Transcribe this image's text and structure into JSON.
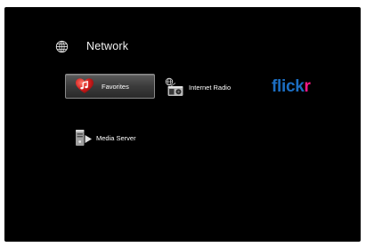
{
  "header": {
    "title": "Network",
    "icon": "globe-icon"
  },
  "menu": {
    "items": [
      {
        "label": "Favorites",
        "icon": "heart-music-icon",
        "selected": true
      },
      {
        "label": "Internet Radio",
        "icon": "radio-icon",
        "selected": false
      },
      {
        "logo_part1": "flick",
        "logo_part2": "r",
        "icon": "flickr-logo",
        "selected": false
      },
      {
        "label": "Media Server",
        "icon": "media-server-icon",
        "selected": false
      }
    ]
  },
  "colors": {
    "background": "#000000",
    "heart_red": "#c81818",
    "flickr_blue": "#1c6ec2",
    "flickr_pink": "#ff1785"
  }
}
